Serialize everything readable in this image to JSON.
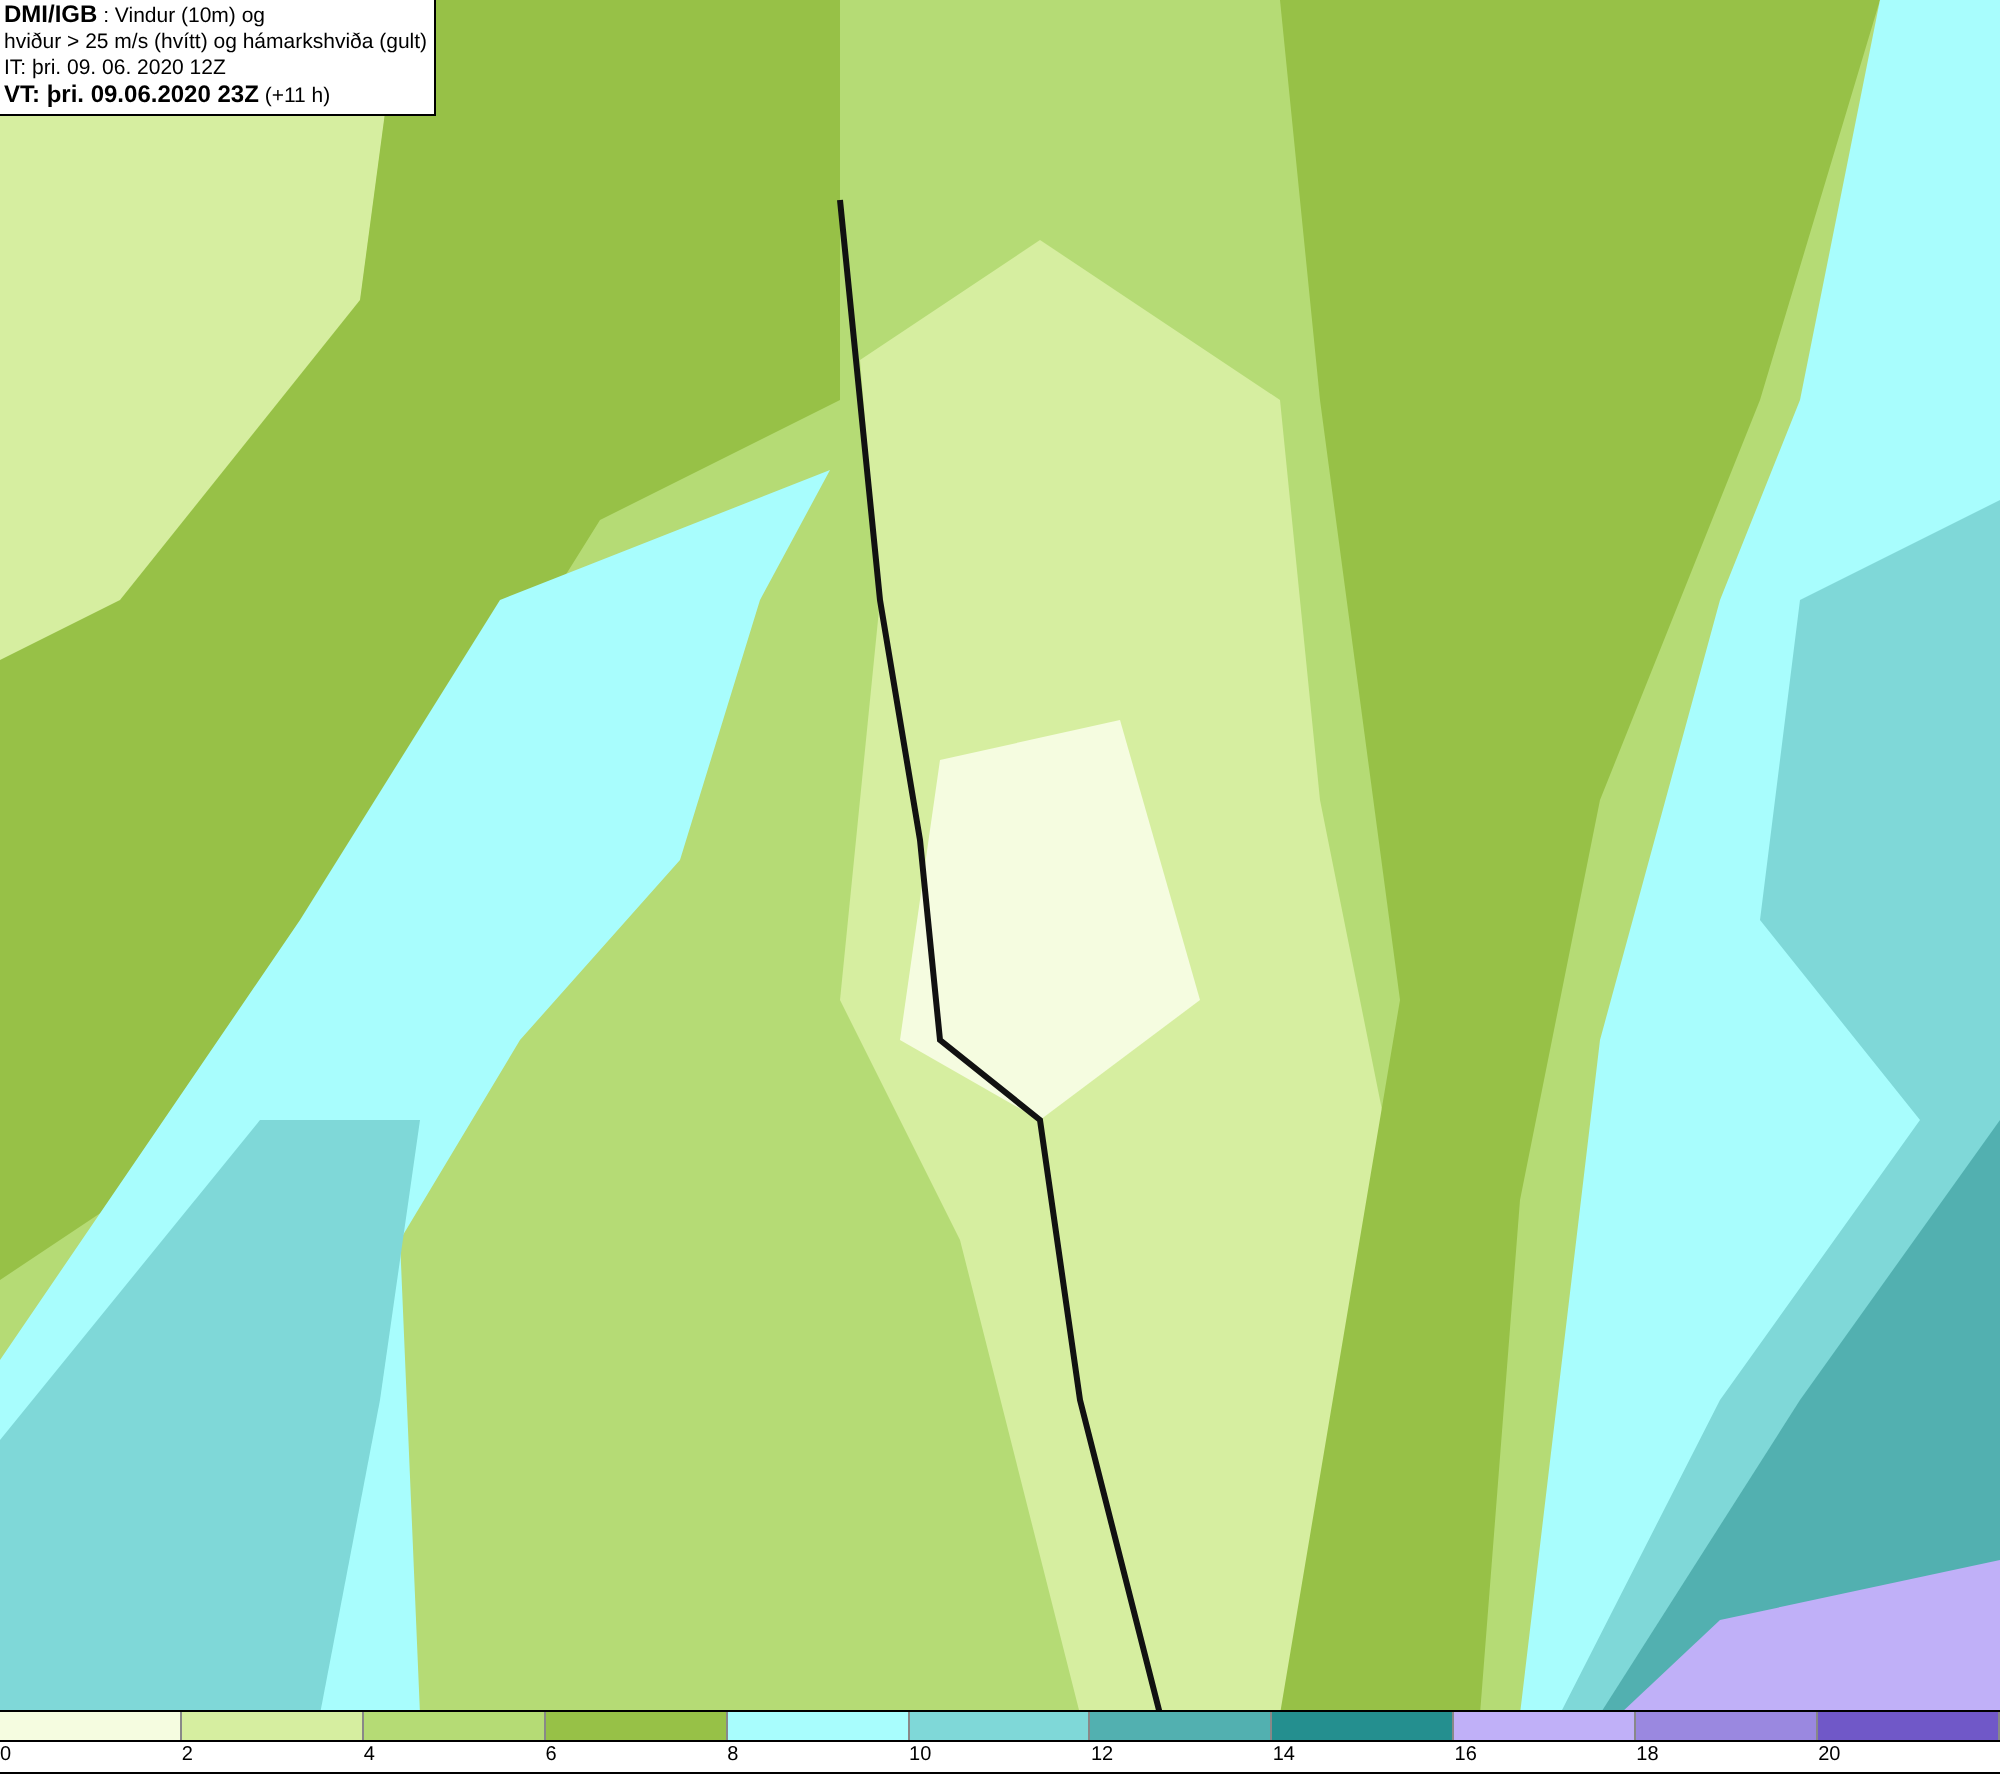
{
  "map": {
    "info_lines": [
      "**DMI/IGB** : Vindur (10m) og",
      "hviður > 25 m/s (hvítt) og hámarkshviða (gult)",
      "IT: þri. 09. 06. 2020 12Z",
      "**VT: þri. 09.06.2020 23Z** (+11 h)"
    ]
  },
  "legend": {
    "bins": [
      {
        "color": "#f5fce0"
      },
      {
        "color": "#d6eea0"
      },
      {
        "color": "#b5db75"
      },
      {
        "color": "#97c147"
      },
      {
        "color": "#a8fdfd"
      },
      {
        "color": "#7fd8d8"
      },
      {
        "color": "#52b0b0"
      },
      {
        "color": "#248f8f"
      },
      {
        "color": "#c0b0f8"
      },
      {
        "color": "#9a88e0"
      },
      {
        "color": "#7058c8"
      }
    ],
    "labels": [
      "0",
      "2",
      "4",
      "6",
      "8",
      "10",
      "12",
      "14",
      "16",
      "18",
      "20"
    ]
  }
}
